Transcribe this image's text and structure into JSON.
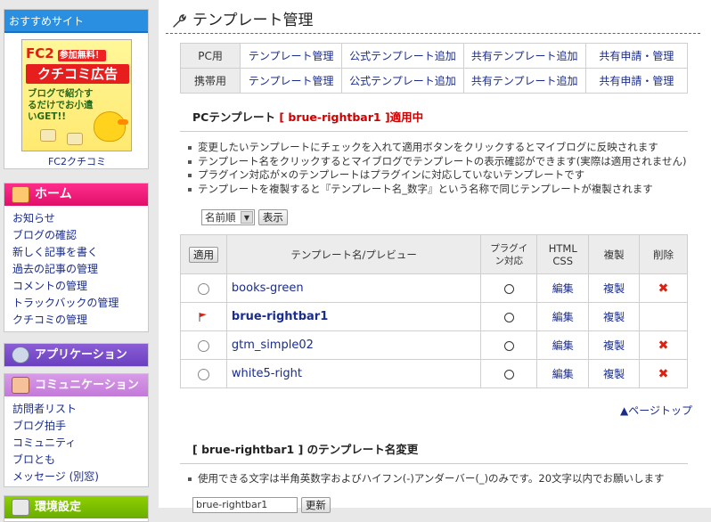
{
  "sidebar": {
    "recommend": {
      "heading": "おすすめサイト",
      "ad_brand": "FC2",
      "ad_badge": "参加無料！",
      "ad_title": "クチコミ広告",
      "ad_text": "ブログで紹介するだけでお小遣いGET!!",
      "caption": "FC2クチコミ"
    },
    "home": {
      "heading": "ホーム",
      "items": [
        "お知らせ",
        "ブログの確認",
        "新しく記事を書く",
        "過去の記事の管理",
        "コメントの管理",
        "トラックバックの管理",
        "クチコミの管理"
      ]
    },
    "app": {
      "heading": "アプリケーション"
    },
    "comm": {
      "heading": "コミュニケーション",
      "items": [
        "訪問者リスト",
        "ブログ拍手",
        "コミュニティ",
        "ブロとも",
        "メッセージ (別窓)"
      ]
    },
    "env": {
      "heading": "環境設定"
    }
  },
  "main": {
    "title": "テンプレート管理",
    "tabs": {
      "pc_label": "PC用",
      "mobile_label": "携帯用",
      "pc_links": [
        "テンプレート管理",
        "公式テンプレート追加",
        "共有テンプレート追加",
        "共有申請・管理"
      ],
      "mobile_links": [
        "テンプレート管理",
        "公式テンプレート追加",
        "共有テンプレート追加",
        "共有申請・管理"
      ]
    },
    "pc_section": {
      "prefix": "PCテンプレート",
      "applied_name": "[ brue-rightbar1 ]",
      "suffix": "適用中",
      "notes": [
        "変更したいテンプレートにチェックを入れて適用ボタンをクリックするとマイブログに反映されます",
        "テンプレート名をクリックするとマイブログでテンプレートの表示確認ができます(実際は適用されません)",
        "プラグイン対応が×のテンプレートはプラグインに対応していないテンプレートです",
        "テンプレートを複製すると『テンプレート名_数字』という名称で同じテンプレートが複製されます"
      ],
      "sort_value": "名前順",
      "show_button": "表示",
      "table": {
        "apply_button": "適用",
        "col_name": "テンプレート名/プレビュー",
        "col_plugin": "プラグイン対応",
        "col_html_css": "HTML CSS",
        "col_copy": "複製",
        "col_delete": "削除",
        "rows": [
          {
            "name": "books-green",
            "plugin": "○",
            "edit": "編集",
            "copy": "複製",
            "deletable": true,
            "active": false
          },
          {
            "name": "brue-rightbar1",
            "plugin": "○",
            "edit": "編集",
            "copy": "複製",
            "deletable": false,
            "active": true
          },
          {
            "name": "gtm_simple02",
            "plugin": "○",
            "edit": "編集",
            "copy": "複製",
            "deletable": true,
            "active": false
          },
          {
            "name": "white5-right",
            "plugin": "○",
            "edit": "編集",
            "copy": "複製",
            "deletable": true,
            "active": false
          }
        ]
      },
      "page_top": "▲ページトップ"
    },
    "rename_section": {
      "title": "[ brue-rightbar1 ] のテンプレート名変更",
      "notes": [
        "使用できる文字は半角英数字およびハイフン(-)アンダーバー(_)のみです。20文字以内でお願いします"
      ],
      "input_value": "brue-rightbar1",
      "button": "更新"
    }
  },
  "colors": {
    "recommend_head": "#2a8fe0",
    "home_head": "#ff2c8c",
    "app_head": "#8b5ed6",
    "comm_head": "#d89be8",
    "env_head": "#8ed000",
    "link": "#1a2c8c",
    "applied_red": "#cc0000"
  }
}
